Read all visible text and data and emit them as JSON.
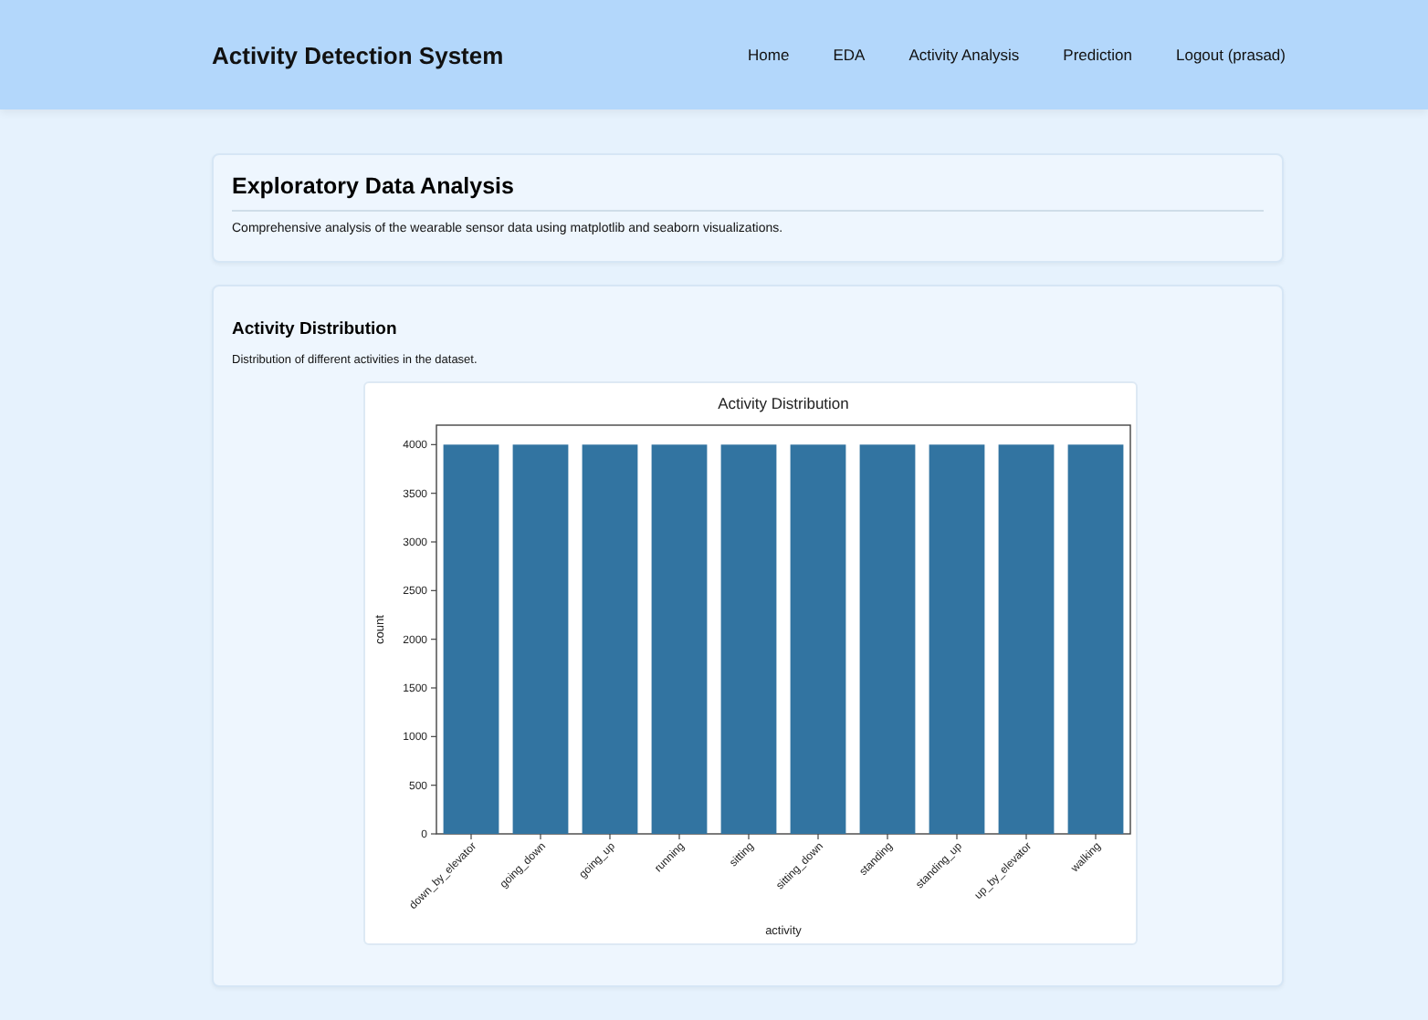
{
  "header": {
    "brand": "Activity Detection System",
    "nav": [
      {
        "label": "Home"
      },
      {
        "label": "EDA"
      },
      {
        "label": "Activity Analysis"
      },
      {
        "label": "Prediction"
      },
      {
        "label": "Logout (prasad)"
      }
    ]
  },
  "intro": {
    "title": "Exploratory Data Analysis",
    "text": "Comprehensive analysis of the wearable sensor data using matplotlib and seaborn visualizations."
  },
  "section": {
    "title": "Activity Distribution",
    "text": "Distribution of different activities in the dataset.",
    "chart_data": {
      "type": "bar",
      "title": "Activity Distribution",
      "xlabel": "activity",
      "ylabel": "count",
      "categories": [
        "down_by_elevator",
        "going_down",
        "going_up",
        "running",
        "sitting",
        "sitting_down",
        "standing",
        "standing_up",
        "up_by_elevator",
        "walking"
      ],
      "series": [
        {
          "color": "#3274a1",
          "values": [
            4000,
            4000,
            4000,
            4000,
            4000,
            4000,
            4000,
            4000,
            4000,
            4000
          ]
        }
      ],
      "ylim": [
        0,
        4200
      ],
      "yticks": [
        0,
        500,
        1000,
        1500,
        2000,
        2500,
        3000,
        3500,
        4000
      ]
    }
  }
}
